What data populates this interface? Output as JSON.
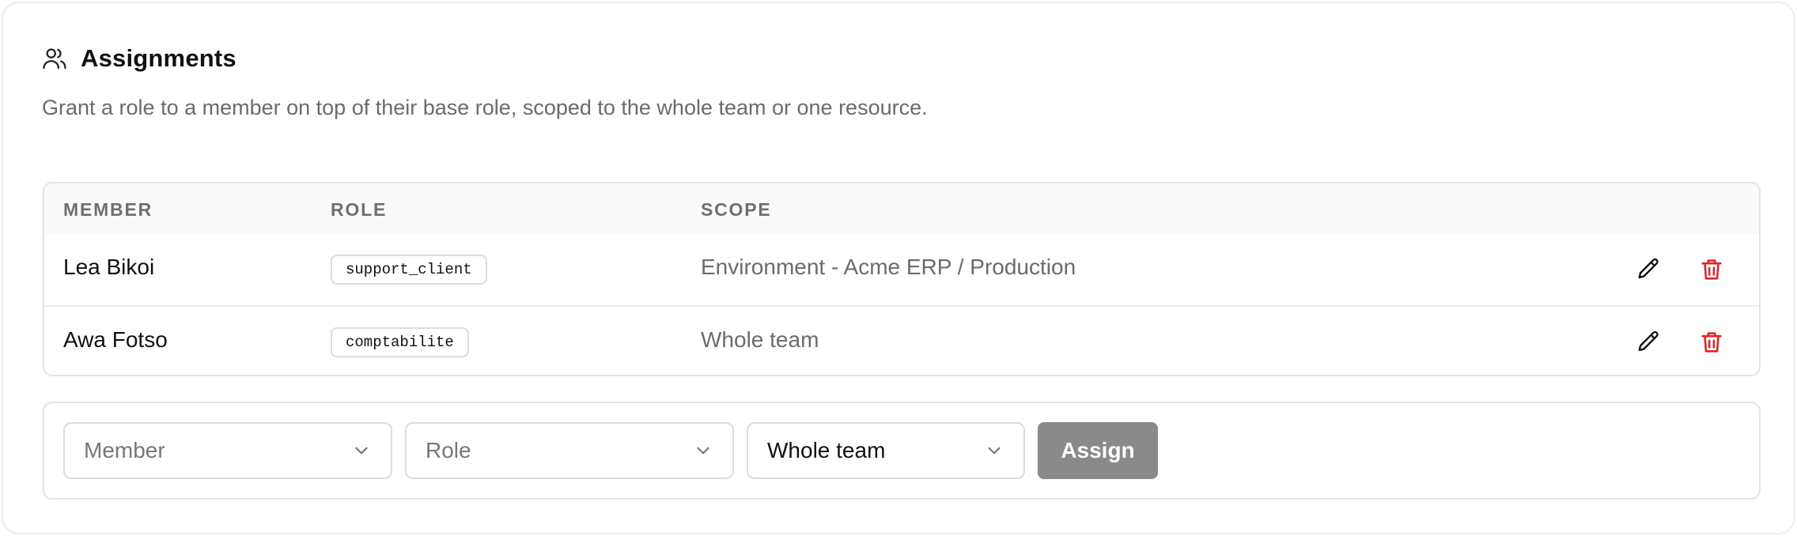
{
  "header": {
    "title": "Assignments",
    "icon": "users-icon",
    "description": "Grant a role to a member on top of their base role, scoped to the whole team or one resource."
  },
  "table": {
    "columns": [
      "MEMBER",
      "ROLE",
      "SCOPE"
    ],
    "rows": [
      {
        "member": "Lea Bikoi",
        "role": "support_client",
        "scope": "Environment - Acme ERP / Production"
      },
      {
        "member": "Awa Fotso",
        "role": "comptabilite",
        "scope": "Whole team"
      }
    ]
  },
  "form": {
    "member_placeholder": "Member",
    "role_placeholder": "Role",
    "scope_value": "Whole team",
    "assign_label": "Assign"
  },
  "colors": {
    "delete_icon": "#dc2626",
    "assign_button_bg": "#8a8a8a",
    "muted_text": "#6b6b6b"
  }
}
